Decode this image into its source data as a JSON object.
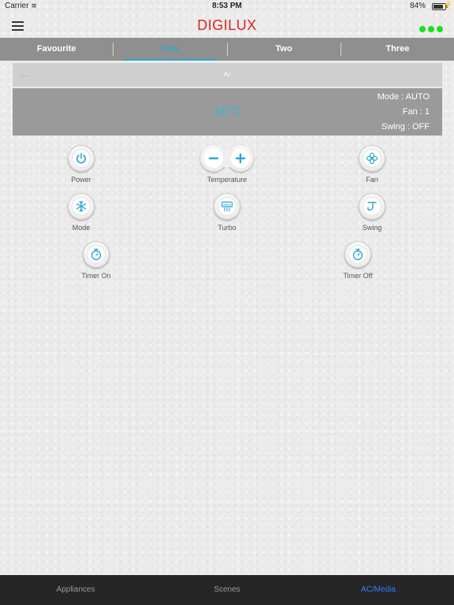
{
  "status_bar": {
    "carrier": "Carrier",
    "time": "8:53 PM",
    "battery": "84%"
  },
  "header": {
    "logo": "DIGILUX"
  },
  "tabs": [
    {
      "label": "Favourite",
      "active": false
    },
    {
      "label": "One",
      "active": true
    },
    {
      "label": "Two",
      "active": false
    },
    {
      "label": "Three",
      "active": false
    }
  ],
  "ac": {
    "title": "Ac",
    "temperature": "16°C",
    "mode": "Mode : AUTO",
    "fan": "Fan : 1",
    "swing": "Swing : OFF"
  },
  "controls": {
    "power": "Power",
    "temperature": "Temperature",
    "fan": "Fan",
    "mode": "Mode",
    "turbo": "Turbo",
    "swing": "Swing",
    "timer_on": "Timer On",
    "timer_off": "Timer Off"
  },
  "bottom_tabs": [
    {
      "label": "Appliances",
      "active": false
    },
    {
      "label": "Scenes",
      "active": false
    },
    {
      "label": "AC/Media",
      "active": true
    }
  ],
  "colors": {
    "accent": "#2ba8cf",
    "logo": "#e0211b",
    "indicator": "#17e11a",
    "bottom_active": "#2a7fff"
  }
}
